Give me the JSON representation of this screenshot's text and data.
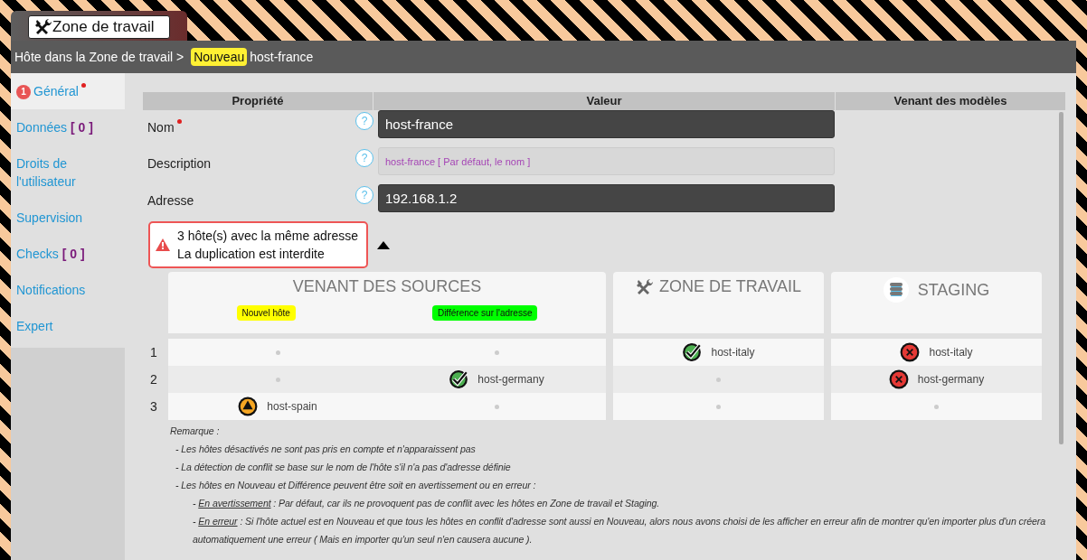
{
  "window": {
    "title": "Zone de travail"
  },
  "breadcrumb": {
    "path": "Hôte dans la Zone de travail >",
    "badge": "Nouveau",
    "name": "host-france"
  },
  "sidebar": {
    "items": [
      {
        "label": "Général",
        "badge": "1",
        "required": true,
        "selected": true
      },
      {
        "label": "Données",
        "count": "[ 0 ]",
        "selected": false
      },
      {
        "label": "Droits de l'utilisateur",
        "selected": false
      },
      {
        "label": "Supervision",
        "selected": false
      },
      {
        "label": "Checks",
        "count": "[ 0 ]",
        "selected": false
      },
      {
        "label": "Notifications",
        "selected": false
      },
      {
        "label": "Expert",
        "selected": false
      }
    ]
  },
  "table": {
    "columns": [
      "Propriété",
      "Valeur",
      "Venant des modèles"
    ],
    "rows": [
      {
        "name": "Nom",
        "required": true,
        "help": "?",
        "kind": "filled",
        "value": "host-france"
      },
      {
        "name": "Description",
        "required": false,
        "help": "?",
        "kind": "empty",
        "placeholder": "host-france [ Par défaut, le nom ]"
      },
      {
        "name": "Adresse",
        "required": false,
        "help": "?",
        "kind": "filled",
        "value": "192.168.1.2"
      }
    ]
  },
  "alert": {
    "lines": [
      "3 hôte(s) avec la même adresse",
      "La duplication est interdite"
    ],
    "expanded": true
  },
  "conflicts": {
    "groups": [
      {
        "title": "VENANT DES SOURCES",
        "kind": "plain",
        "tags": [
          {
            "label": "Nouvel hôte",
            "color": "#ffff00"
          },
          {
            "label": "Différence sur l'adresse",
            "color": "#00ff00"
          }
        ]
      },
      {
        "title": "ZONE DE TRAVAIL",
        "kind": "tools"
      },
      {
        "title": "STAGING",
        "kind": "database"
      }
    ],
    "rows": [
      {
        "number": "1",
        "cells": [
          {
            "kind": "empty"
          },
          {
            "kind": "empty"
          },
          {
            "kind": "ok",
            "host": "host-italy"
          },
          {
            "kind": "error",
            "host": "host-italy"
          }
        ]
      },
      {
        "number": "2",
        "cells": [
          {
            "kind": "empty"
          },
          {
            "kind": "ok",
            "host": "host-germany"
          },
          {
            "kind": "empty"
          },
          {
            "kind": "error",
            "host": "host-germany"
          }
        ]
      },
      {
        "number": "3",
        "cells": [
          {
            "kind": "warning",
            "host": "host-spain"
          },
          {
            "kind": "empty"
          },
          {
            "kind": "empty"
          },
          {
            "kind": "empty"
          }
        ]
      }
    ]
  },
  "remarks": {
    "title": "Remarque :",
    "items": [
      {
        "text": "- Les hôtes désactivés ne sont pas pris en compte et n'apparaissent pas"
      },
      {
        "text": "- La détection de conflit se base sur le nom de l'hôte s'il n'a pas d'adresse définie"
      },
      {
        "text": "- Les hôtes en Nouveau et Différence peuvent être soit en avertissement ou en erreur :",
        "children": [
          {
            "prefix": "- ",
            "term": "En avertissement",
            "text": " : Par défaut, car ils ne provoquent pas de conflit avec les hôtes en Zone de travail et Staging."
          },
          {
            "prefix": "- ",
            "term": "En erreur",
            "text": " : Si l'hôte actuel est en Nouveau et que tous les hôtes en conflit d'adresse sont aussi en Nouveau, alors nous avons choisi de les afficher en erreur afin de montrer qu'en importer plus d'un créera automatiquement une erreur ( Mais en importer qu'un seul n'en causera aucune )."
          }
        ]
      }
    ]
  }
}
